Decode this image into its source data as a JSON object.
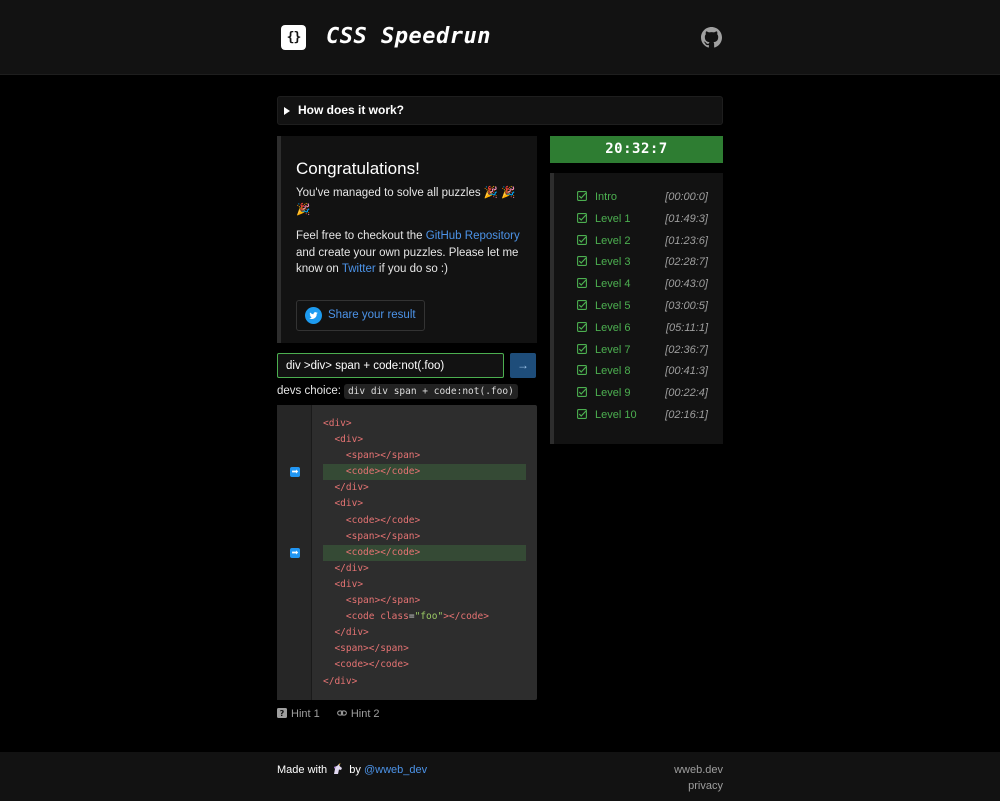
{
  "header": {
    "logo_text": "{}",
    "title": "CSS Speedrun",
    "github_icon": "github-icon"
  },
  "how": {
    "label": "How does it work?"
  },
  "congrats": {
    "heading": "Congratulations!",
    "line1": "You've managed to solve all puzzles 🎉 🎉 🎉",
    "p2_a": "Feel free to checkout the ",
    "github_link": "GitHub Repository",
    "p2_b": " and create your own puzzles. Please let me know on ",
    "twitter_link": "Twitter",
    "p2_c": " if you do so :)",
    "share_label": "Share your result"
  },
  "timer": "20:32:7",
  "levels": [
    {
      "name": "Intro",
      "time": "[00:00:0]"
    },
    {
      "name": "Level 1",
      "time": "[01:49:3]"
    },
    {
      "name": "Level 2",
      "time": "[01:23:6]"
    },
    {
      "name": "Level 3",
      "time": "[02:28:7]"
    },
    {
      "name": "Level 4",
      "time": "[00:43:0]"
    },
    {
      "name": "Level 5",
      "time": "[03:00:5]"
    },
    {
      "name": "Level 6",
      "time": "[05:11:1]"
    },
    {
      "name": "Level 7",
      "time": "[02:36:7]"
    },
    {
      "name": "Level 8",
      "time": "[00:41:3]"
    },
    {
      "name": "Level 9",
      "time": "[00:22:4]"
    },
    {
      "name": "Level 10",
      "time": "[02:16:1]"
    }
  ],
  "selector": {
    "value": "div >div> span + code:not(.foo)",
    "submit": "→"
  },
  "devs": {
    "label": "devs choice:",
    "code": "div div span + code:not(.foo)"
  },
  "code_lines": [
    {
      "indent": 0,
      "tag": "div",
      "close": false,
      "kind": "open"
    },
    {
      "indent": 1,
      "tag": "div",
      "kind": "open"
    },
    {
      "indent": 2,
      "tag": "span",
      "kind": "pair"
    },
    {
      "indent": 2,
      "tag": "code",
      "kind": "pair",
      "hl": true
    },
    {
      "indent": 1,
      "tag": "div",
      "kind": "close"
    },
    {
      "indent": 1,
      "tag": "div",
      "kind": "open"
    },
    {
      "indent": 2,
      "tag": "code",
      "kind": "pair"
    },
    {
      "indent": 2,
      "tag": "span",
      "kind": "pair"
    },
    {
      "indent": 2,
      "tag": "code",
      "kind": "pair",
      "hl": true
    },
    {
      "indent": 1,
      "tag": "div",
      "kind": "close"
    },
    {
      "indent": 1,
      "tag": "div",
      "kind": "open"
    },
    {
      "indent": 2,
      "tag": "span",
      "kind": "pair"
    },
    {
      "indent": 2,
      "tag": "code",
      "kind": "pair",
      "attr": "class",
      "val": "\"foo\""
    },
    {
      "indent": 1,
      "tag": "div",
      "kind": "close"
    },
    {
      "indent": 1,
      "tag": "span",
      "kind": "pair"
    },
    {
      "indent": 1,
      "tag": "code",
      "kind": "pair"
    },
    {
      "indent": 0,
      "tag": "div",
      "kind": "close"
    }
  ],
  "hints": [
    "Hint 1",
    "Hint 2"
  ],
  "footer": {
    "made_with": "Made with",
    "by": "by",
    "handle": "@wweb_dev",
    "site": "wweb.dev",
    "privacy": "privacy"
  },
  "colors": {
    "accent": "#4c93e8",
    "success": "#4caf50",
    "timer_bg": "#2e7d32"
  }
}
